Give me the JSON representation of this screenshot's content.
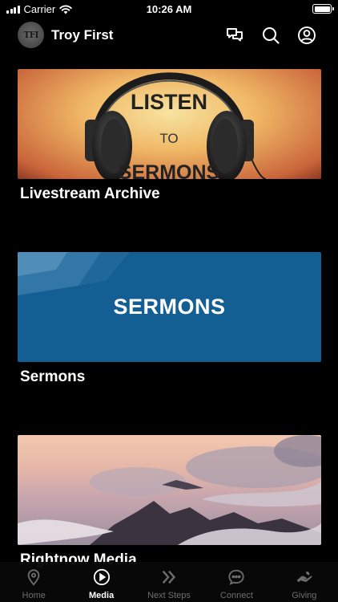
{
  "status_bar": {
    "carrier": "Carrier",
    "time": "10:26 AM",
    "battery_level": 1.0
  },
  "header": {
    "title": "Troy First",
    "avatar_icon": "church-logo-icon",
    "actions": [
      {
        "icon": "chat-bubbles-icon"
      },
      {
        "icon": "search-icon"
      },
      {
        "icon": "profile-icon"
      }
    ]
  },
  "feed": {
    "items": [
      {
        "title": "Livestream Archive",
        "image": {
          "icon": "headphones-icon",
          "line1": "LISTEN",
          "line2": "TO",
          "line3": "SERMONS"
        }
      },
      {
        "title": "Sermons",
        "image": {
          "text": "SERMONS"
        }
      },
      {
        "title": "Rightnow Media",
        "image": {
          "icon": "mountain-clouds-icon"
        }
      }
    ]
  },
  "tab_bar": {
    "tabs": [
      {
        "label": "Home",
        "icon": "location-pin-icon",
        "active": false
      },
      {
        "label": "Media",
        "icon": "play-circle-icon",
        "active": true
      },
      {
        "label": "Next Steps",
        "icon": "double-chevron-icon",
        "active": false
      },
      {
        "label": "Connect",
        "icon": "chat-dots-icon",
        "active": false
      },
      {
        "label": "Giving",
        "icon": "giving-hand-icon",
        "active": false
      }
    ]
  },
  "colors": {
    "background": "#000000",
    "sermons_blue": "#135e92",
    "tab_inactive": "#6e6e6e",
    "tab_active": "#ffffff"
  }
}
